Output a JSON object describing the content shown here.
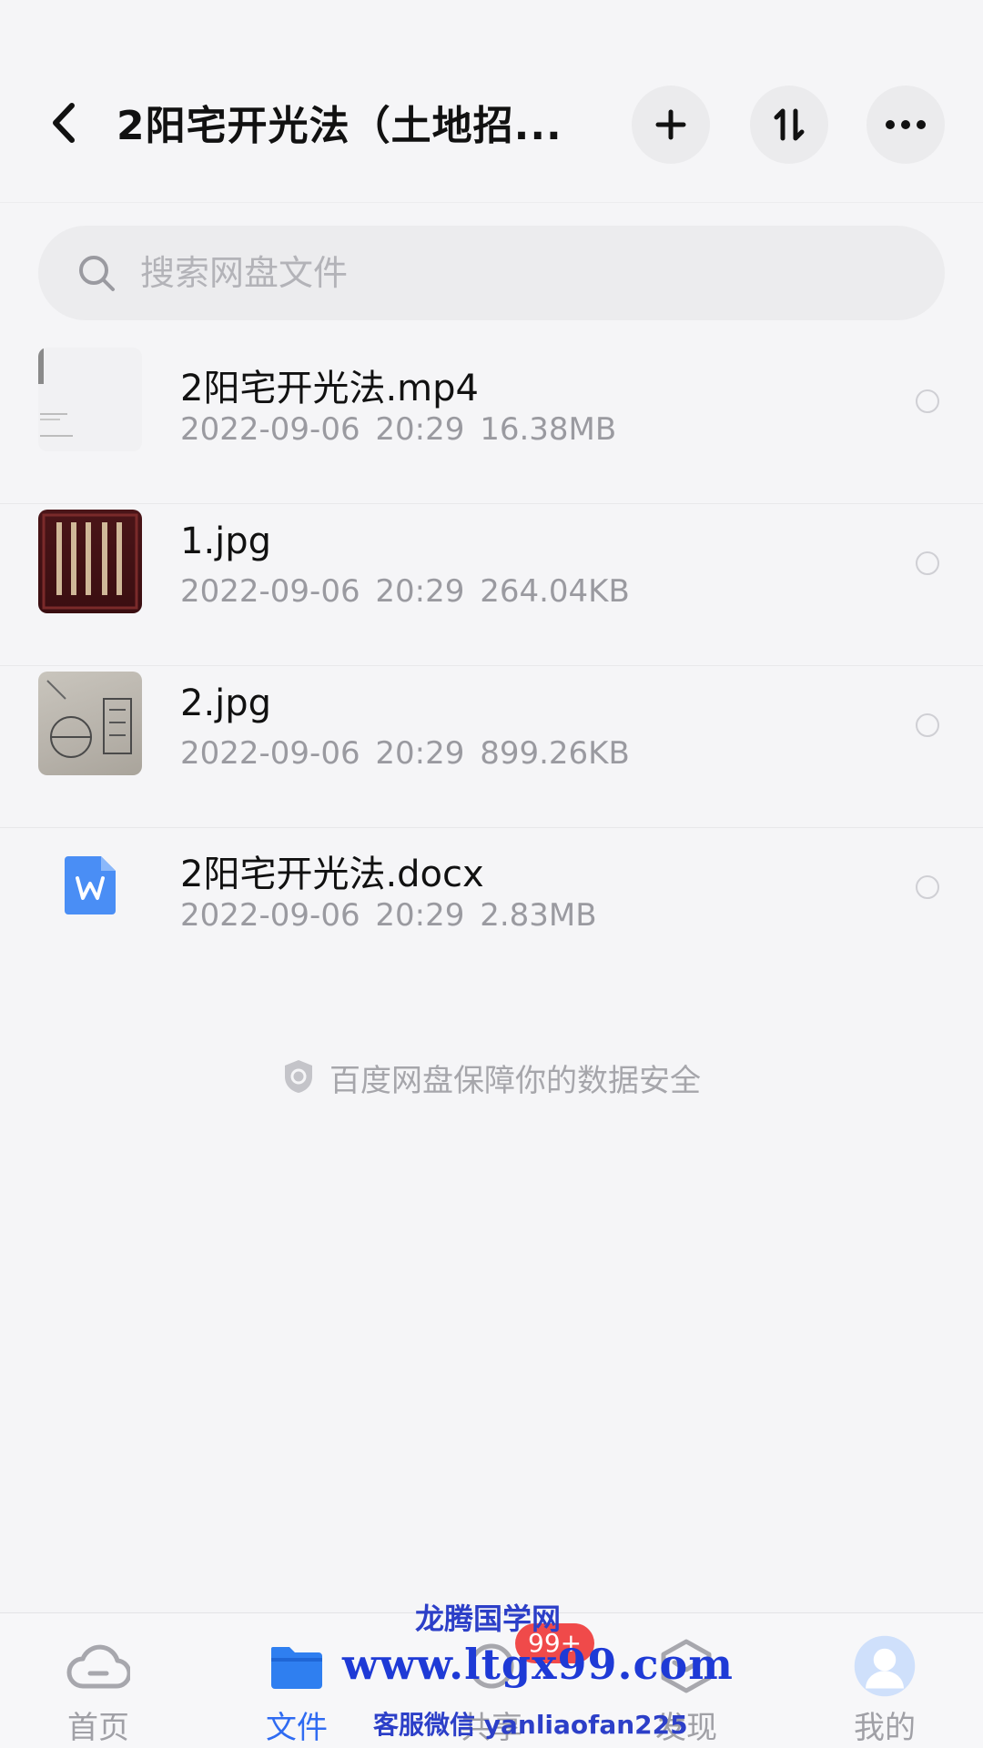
{
  "header": {
    "title": "2阳宅开光法（土地招...",
    "buttons": {
      "add": "plus-icon",
      "sort": "sort-icon",
      "more": "more-dots-icon"
    }
  },
  "search": {
    "placeholder": "搜索网盘文件"
  },
  "files": [
    {
      "name": "2阳宅开光法.mp4",
      "date": "2022-09-06",
      "time": "20:29",
      "size": "16.38MB",
      "type": "video"
    },
    {
      "name": "1.jpg",
      "date": "2022-09-06",
      "time": "20:29",
      "size": "264.04KB",
      "type": "image"
    },
    {
      "name": "2.jpg",
      "date": "2022-09-06",
      "time": "20:29",
      "size": "899.26KB",
      "type": "image"
    },
    {
      "name": "2阳宅开光法.docx",
      "date": "2022-09-06",
      "time": "20:29",
      "size": "2.83MB",
      "type": "document"
    }
  ],
  "security_note": "百度网盘保障你的数据安全",
  "tabbar": {
    "tabs": [
      {
        "label": "首页",
        "icon": "cloud-home-icon",
        "active": false
      },
      {
        "label": "文件",
        "icon": "folder-icon",
        "active": true
      },
      {
        "label": "共享",
        "icon": "share-icon",
        "active": false
      },
      {
        "label": "发现",
        "icon": "discover-icon",
        "active": false
      },
      {
        "label": "我的",
        "icon": "avatar-icon",
        "active": false
      }
    ],
    "badge": "99+"
  },
  "watermark": {
    "line1": "龙腾国学网",
    "line2": "www.ltgx99.com",
    "line3": "客服微信 yanliaofan225"
  },
  "colors": {
    "accent": "#2f6bf2",
    "badge": "#f04a4a",
    "watermark": "#1e3ad6"
  }
}
